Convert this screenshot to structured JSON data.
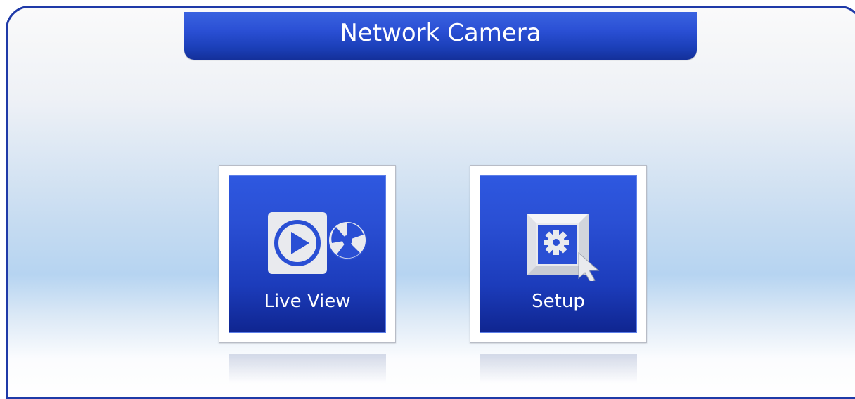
{
  "header": {
    "title": "Network Camera"
  },
  "tiles": [
    {
      "label": "Live View",
      "icon": "live-view-icon"
    },
    {
      "label": "Setup",
      "icon": "setup-icon"
    }
  ],
  "colors": {
    "frame_border": "#1f3aa8",
    "tile_blue": "#2a4fd4",
    "title_blue": "#2a4fd4"
  }
}
